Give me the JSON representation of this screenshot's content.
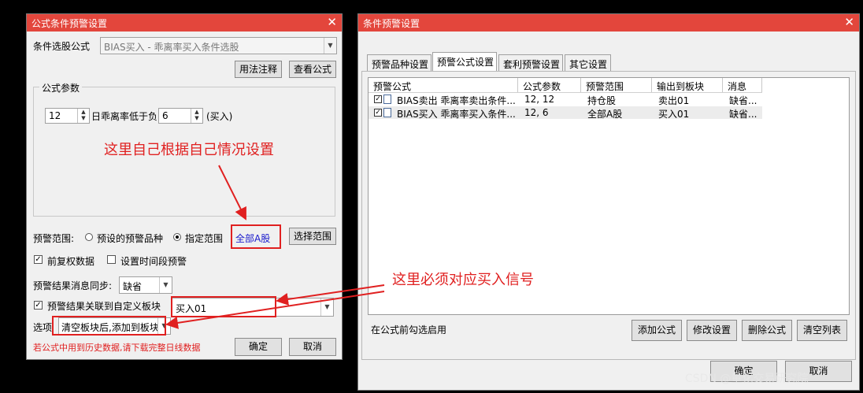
{
  "left_dialog": {
    "title": "公式条件预警设置",
    "close": "✕",
    "formula_label": "条件选股公式",
    "formula_value": "BIAS买入  -  乖离率买入条件选股",
    "usage_button": "用法注释",
    "view_formula_button": "查看公式",
    "params_group": "公式参数",
    "param1_value": "12",
    "param_label": "日乖离率低于负",
    "param2_value": "6",
    "param_suffix": "(买入)",
    "annotation_settings": "这里自己根据自己情况设置",
    "range_label": "预警范围:",
    "range_option1": "预设的预警品种",
    "range_option2": "指定范围",
    "range_value": "全部A股",
    "select_range_button": "选择范围",
    "adjusted_label": "前复权数据",
    "time_period_label": "设置时间段预警",
    "sync_label": "预警结果消息同步:",
    "sync_value": "缺省",
    "link_block_label": "预警结果关联到自定义板块",
    "block_value": "买入01",
    "option_label": "选项",
    "option_value": "清空板块后,添加到板块",
    "note": "若公式中用到历史数据,请下载完整日线数据",
    "ok_button": "确定",
    "cancel_button": "取消"
  },
  "annotation_signal": "这里必须对应买入信号",
  "right_dialog": {
    "title": "条件预警设置",
    "close": "✕",
    "tabs": [
      "预警品种设置",
      "预警公式设置",
      "套利预警设置",
      "其它设置"
    ],
    "columns": [
      "预警公式",
      "公式参数",
      "预警范围",
      "输出到板块",
      "消息"
    ],
    "rows": [
      {
        "check": "✓",
        "formula": "BIAS卖出 乖离率卖出条件...",
        "params": "12, 12",
        "range": "持仓股",
        "block": "卖出01",
        "msg": "缺省..."
      },
      {
        "check": "✓",
        "formula": "BIAS买入 乖离率买入条件...",
        "params": "12, 6",
        "range": "全部A股",
        "block": "买入01",
        "msg": "缺省..."
      }
    ],
    "hint": "在公式前勾选启用",
    "add_button": "添加公式",
    "modify_button": "修改设置",
    "delete_button": "删除公式",
    "clear_button": "清空列表",
    "ok_button": "确定",
    "cancel_button": "取消"
  },
  "watermark": "CSDN @量化交易研究院"
}
